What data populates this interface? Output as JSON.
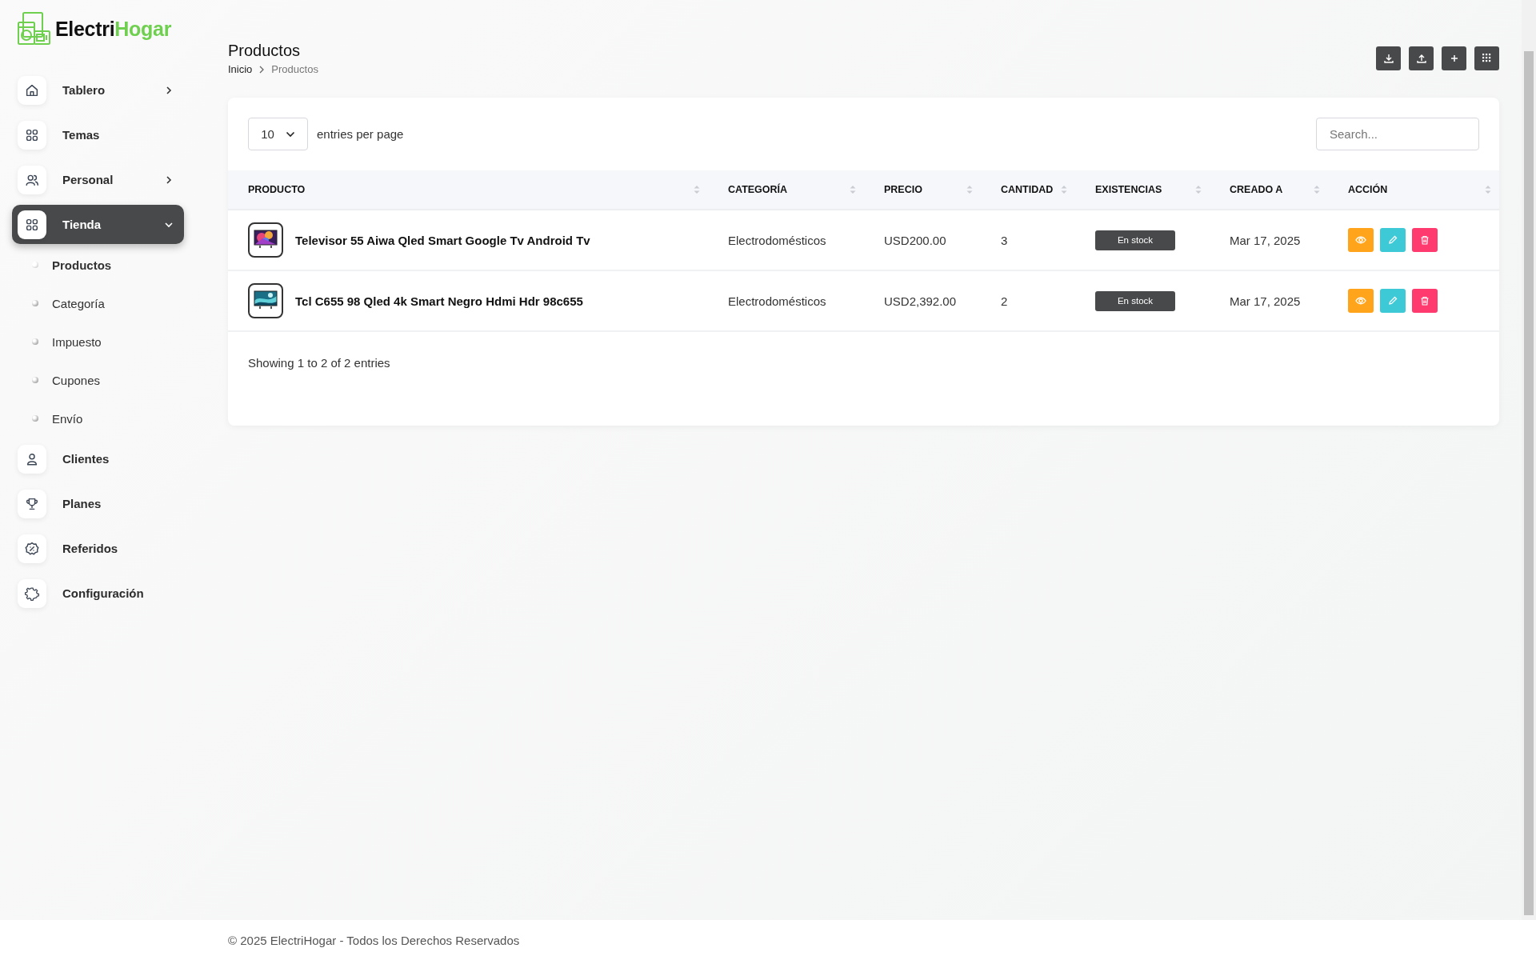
{
  "brand": {
    "name": "Electri",
    "name_accent": "Hogar"
  },
  "sidebar": {
    "items": [
      {
        "label": "Tablero",
        "expanded": false,
        "selected": false
      },
      {
        "label": "Temas",
        "selected": false
      },
      {
        "label": "Personal",
        "expanded": false,
        "selected": false
      },
      {
        "label": "Tienda",
        "expanded": true,
        "selected": true,
        "children": [
          {
            "label": "Productos",
            "selected": true
          },
          {
            "label": "Categoría",
            "selected": false
          },
          {
            "label": "Impuesto",
            "selected": false
          },
          {
            "label": "Cupones",
            "selected": false
          },
          {
            "label": "Envío",
            "selected": false
          }
        ]
      },
      {
        "label": "Clientes",
        "selected": false
      },
      {
        "label": "Planes",
        "selected": false
      },
      {
        "label": "Referidos",
        "selected": false
      },
      {
        "label": "Configuración",
        "selected": false
      }
    ]
  },
  "page": {
    "title": "Productos",
    "breadcrumb": [
      "Inicio",
      "Productos"
    ],
    "toolbar": [
      {
        "kind": "download"
      },
      {
        "kind": "upload"
      },
      {
        "kind": "add"
      },
      {
        "kind": "grid"
      }
    ]
  },
  "table": {
    "entries_value": "10",
    "entries_label": "entries per page",
    "search": {
      "placeholder": "Search..."
    },
    "columns": [
      "PRODUCTO",
      "CATEGORÍA",
      "PRECIO",
      "CANTIDAD",
      "EXISTENCIAS",
      "CREADO A",
      "ACCIÓN"
    ],
    "rows": [
      {
        "image": {
          "kind": "picture"
        },
        "product": "Televisor 55 Aiwa Qled Smart Google Tv Android Tv",
        "category": "Electrodomésticos",
        "price": "USD200.00",
        "quantity": "3",
        "stock": "En stock",
        "created": "Mar 17, 2025",
        "actions": [
          {
            "kind": "view"
          },
          {
            "kind": "edit"
          },
          {
            "kind": "delete"
          }
        ]
      },
      {
        "image": {
          "kind": "picture"
        },
        "product": "Tcl C655 98 Qled 4k Smart Negro Hdmi Hdr 98c655",
        "category": "Electrodomésticos",
        "price": "USD2,392.00",
        "quantity": "2",
        "stock": "En stock",
        "created": "Mar 17, 2025",
        "actions": [
          {
            "kind": "view"
          },
          {
            "kind": "edit"
          },
          {
            "kind": "delete"
          }
        ]
      }
    ],
    "summary": "Showing 1 to 2 of 2 entries"
  },
  "footer": "© 2025 ElectriHogar - Todos los Derechos Reservados"
}
